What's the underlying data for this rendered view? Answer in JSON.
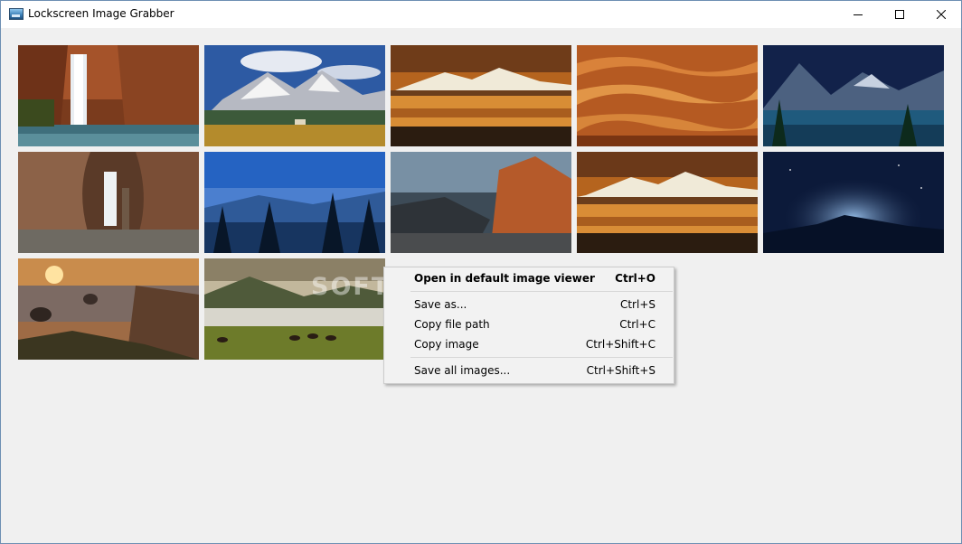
{
  "window": {
    "title": "Lockscreen Image Grabber"
  },
  "titlebar": {
    "minimize_icon": "minimize-icon",
    "maximize_icon": "maximize-icon",
    "close_icon": "close-icon"
  },
  "gallery": {
    "images": [
      {
        "scene": "waterfall in red canyon"
      },
      {
        "scene": "alpine meadow with clouds"
      },
      {
        "scene": "mountain lake at sunset"
      },
      {
        "scene": "terraced fields orange"
      },
      {
        "scene": "blue mountain lake night"
      },
      {
        "scene": "slot canyon waterfall"
      },
      {
        "scene": "blue misty forest hills"
      },
      {
        "scene": "coastal rocks at dusk"
      },
      {
        "scene": "mountain lake reflection sunset"
      },
      {
        "scene": "starry night sky over mountains"
      },
      {
        "scene": "sea cliffs at sunset"
      },
      {
        "scene": "horses grazing in misty valley"
      }
    ]
  },
  "context_menu": {
    "items": [
      {
        "label": "Open in default image viewer",
        "shortcut": "Ctrl+O"
      },
      {
        "label": "Save as...",
        "shortcut": "Ctrl+S"
      },
      {
        "label": "Copy file path",
        "shortcut": "Ctrl+C"
      },
      {
        "label": "Copy image",
        "shortcut": "Ctrl+Shift+C"
      },
      {
        "label": "Save all images...",
        "shortcut": "Ctrl+Shift+S"
      }
    ]
  },
  "watermark": "SOFTPEDIA"
}
